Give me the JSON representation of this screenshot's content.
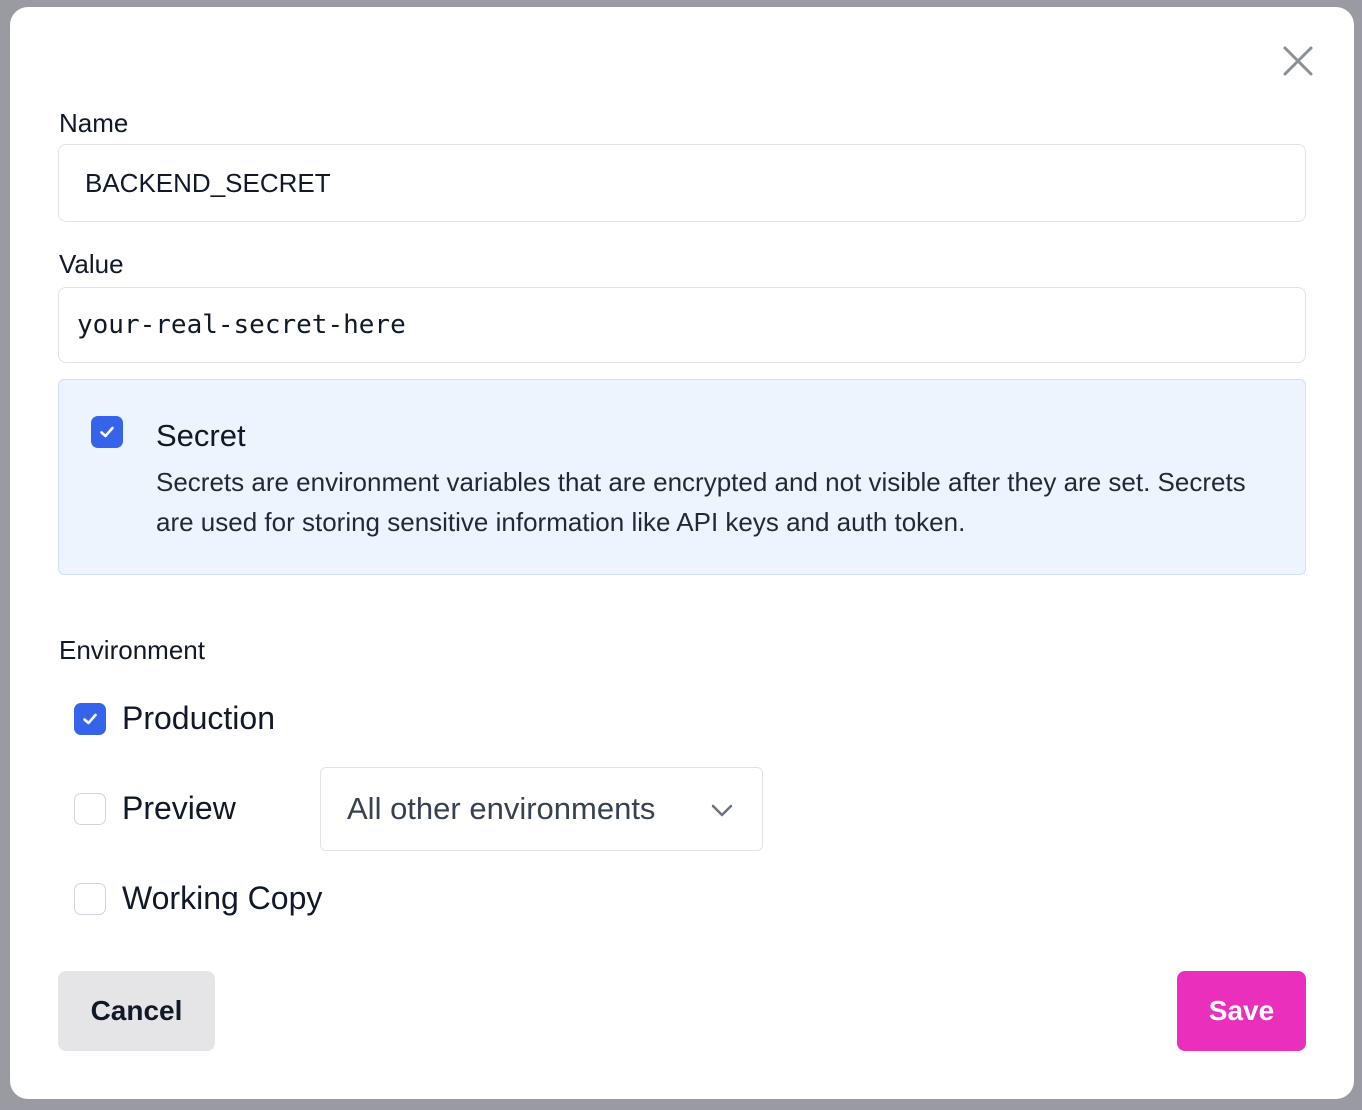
{
  "dialog": {
    "close_icon": "close-icon"
  },
  "name_field": {
    "label": "Name",
    "value": "BACKEND_SECRET"
  },
  "value_field": {
    "label": "Value",
    "value": "your-real-secret-here"
  },
  "secret_option": {
    "checked": true,
    "title": "Secret",
    "description": "Secrets are environment variables that are encrypted and not visible after they are set. Secrets are used for storing sensitive information like API keys and auth token."
  },
  "environment": {
    "label": "Environment",
    "options": [
      {
        "label": "Production",
        "checked": true
      },
      {
        "label": "Preview",
        "checked": false
      },
      {
        "label": "Working Copy",
        "checked": false
      }
    ],
    "preview_scope_select": {
      "selected": "All other environments"
    }
  },
  "actions": {
    "cancel_label": "Cancel",
    "save_label": "Save"
  },
  "colors": {
    "accent_checkbox": "#3563e9",
    "save_button": "#ea2fbd",
    "secret_box_bg": "#eef4fd"
  }
}
